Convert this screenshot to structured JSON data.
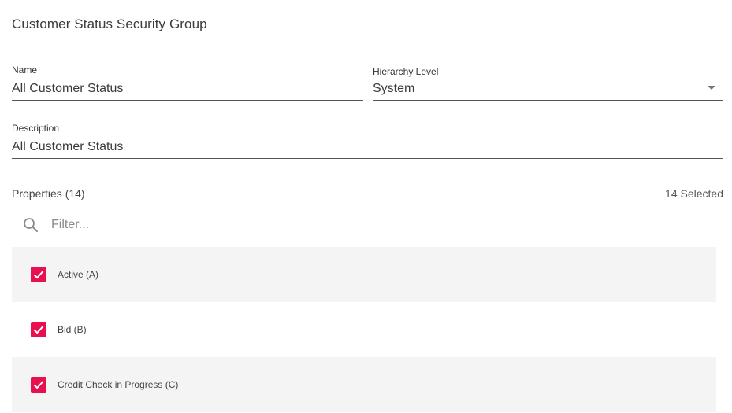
{
  "page": {
    "title": "Customer Status Security Group"
  },
  "form": {
    "name": {
      "label": "Name",
      "value": "All Customer Status"
    },
    "hierarchy_level": {
      "label": "Hierarchy Level",
      "value": "System"
    },
    "description": {
      "label": "Description",
      "value": "All Customer Status"
    }
  },
  "properties": {
    "title": "Properties (14)",
    "selected_count": "14 Selected",
    "filter_placeholder": "Filter...",
    "items": [
      {
        "label": "Active (A)",
        "checked": true
      },
      {
        "label": "Bid (B)",
        "checked": true
      },
      {
        "label": "Credit Check in Progress (C)",
        "checked": true
      }
    ]
  },
  "colors": {
    "checkbox": "#e8114f",
    "row_shade": "#f4f4f4"
  },
  "icons": {
    "filter": "search-icon",
    "dropdown": "dropdown-arrow-icon",
    "check": "checkmark-icon"
  }
}
